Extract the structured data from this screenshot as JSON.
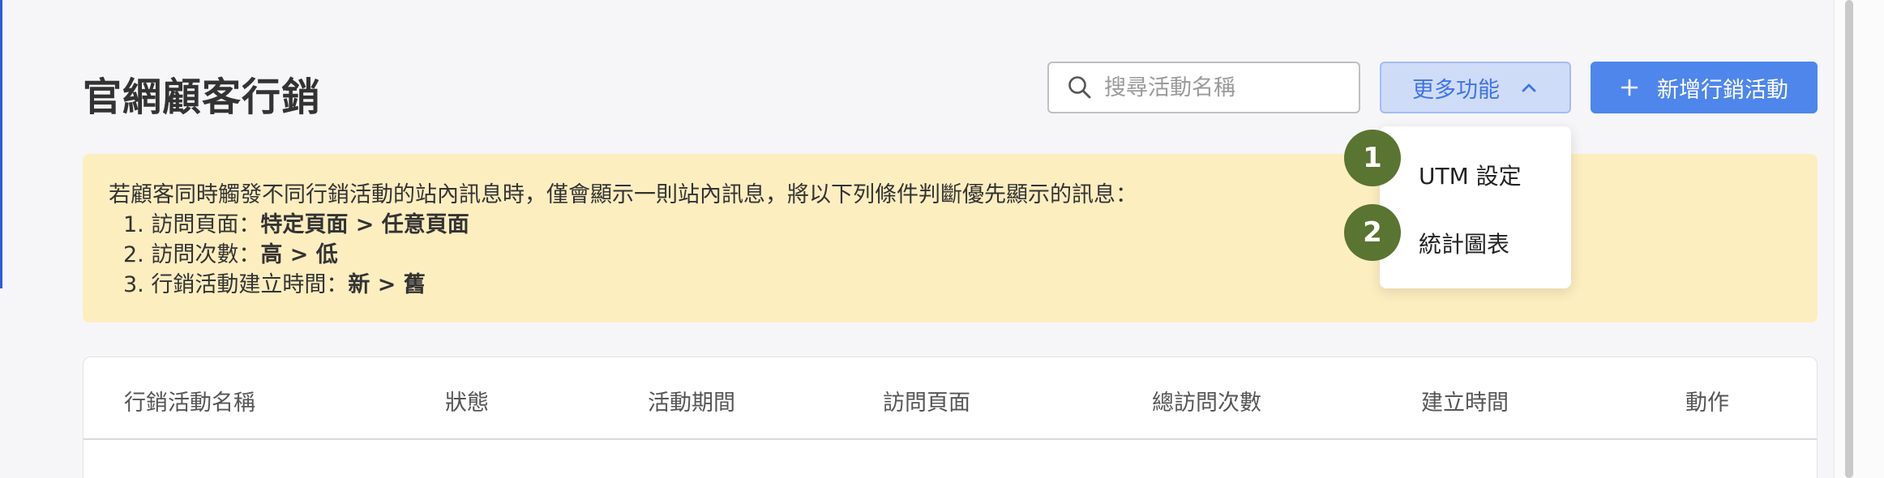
{
  "page": {
    "title": "官網顧客行銷"
  },
  "search": {
    "placeholder": "搜尋活動名稱",
    "value": ""
  },
  "toolbar": {
    "more_label": "更多功能",
    "add_label": "新增行銷活動"
  },
  "dropdown": {
    "items": [
      {
        "badge": "1",
        "label": "UTM 設定"
      },
      {
        "badge": "2",
        "label": "統計圖表"
      }
    ]
  },
  "notice": {
    "intro": "若顧客同時觸發不同行銷活動的站內訊息時，僅會顯示一則站內訊息，將以下列條件判斷優先顯示的訊息：",
    "rules": [
      {
        "prefix": "1. 訪問頁面：",
        "emphasis": "特定頁面 > 任意頁面"
      },
      {
        "prefix": "2. 訪問次數：",
        "emphasis": "高 > 低"
      },
      {
        "prefix": "3. 行銷活動建立時間：",
        "emphasis": "新 > 舊"
      }
    ]
  },
  "table": {
    "columns": [
      "行銷活動名稱",
      "狀態",
      "活動期間",
      "訪問頁面",
      "總訪問次數",
      "建立時間",
      "動作"
    ]
  },
  "colors": {
    "primary": "#4e86ec",
    "primary_light": "#cfdcf8",
    "notice_bg": "#fdeec0",
    "badge": "#5a7432"
  },
  "icons": {
    "search": "search-icon",
    "more_toggle": "chevron-up-icon",
    "add": "plus-icon"
  }
}
